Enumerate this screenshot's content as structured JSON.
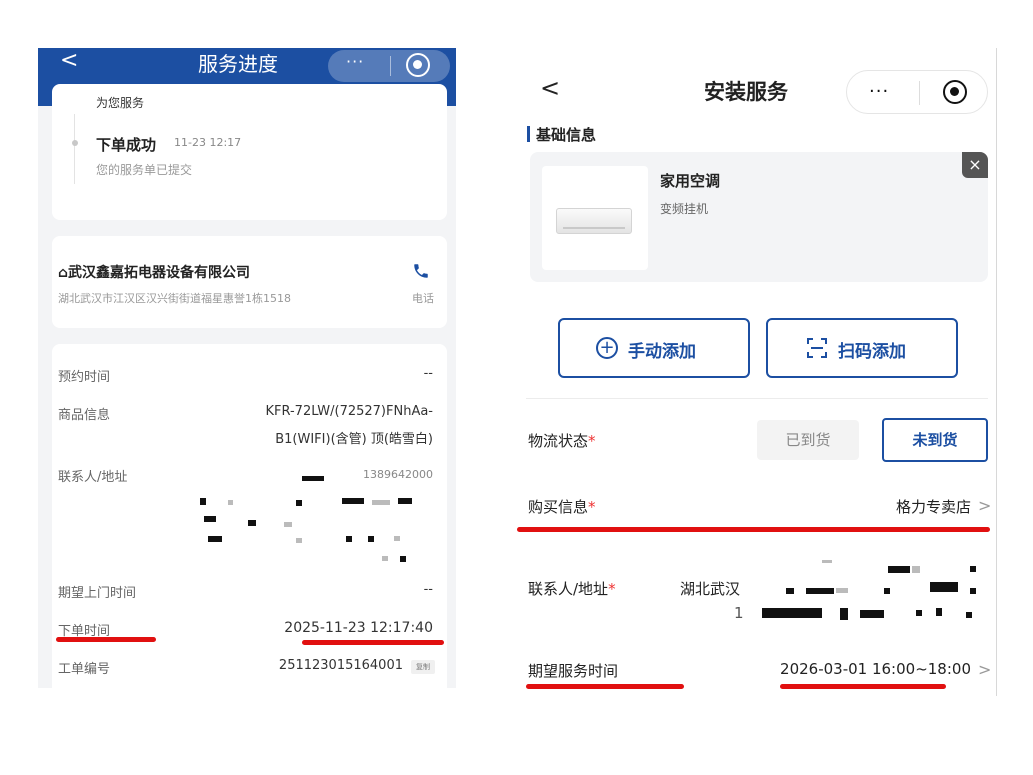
{
  "left": {
    "header": {
      "back_label": "<",
      "title": "服务进度",
      "more_icon": "···",
      "close_icon": "target-icon"
    },
    "progress": {
      "prev_text": "为您服务",
      "status": "下单成功",
      "time": "11-23 12:17",
      "sub": "您的服务单已提交"
    },
    "shop": {
      "name": "武汉鑫嘉拓电器设备有限公司",
      "address": "湖北武汉市江汉区汉兴街街道福星惠誉1栋1518",
      "phone_label": "电话"
    },
    "details": {
      "appt_label": "预约时间",
      "appt_value": "--",
      "product_label": "商品信息",
      "product_value_1": "KFR-72LW/(72527)FNhAa-",
      "product_value_2": "B1(WIFI)(含管) 顶(皓雪白)",
      "contact_label": "联系人/地址",
      "contact_partial": "1389642000",
      "visit_label": "期望上门时间",
      "visit_value": "--",
      "order_time_label": "下单时间",
      "order_time_value": "2025-11-23 12:17:40",
      "order_no_label": "工单编号",
      "order_no_value": "251123015164001",
      "copy_label": "复制"
    }
  },
  "right": {
    "header": {
      "back_label": "<",
      "title": "安装服务",
      "more_icon": "···",
      "close_icon": "target-icon"
    },
    "section_title": "基础信息",
    "product": {
      "name": "家用空调",
      "sub": "变频挂机",
      "close_label": "×"
    },
    "buttons": {
      "manual": "手动添加",
      "scan": "扫码添加"
    },
    "logistics": {
      "label": "物流状态",
      "req": "*",
      "option_arrived": "已到货",
      "option_not_arrived": "未到货"
    },
    "purchase": {
      "label": "购买信息",
      "req": "*",
      "value": "格力专卖店",
      "chevron": ">"
    },
    "contact": {
      "label": "联系人/地址",
      "req": "*",
      "value_partial": "湖北武汉",
      "value_partial2": "1"
    },
    "service_time": {
      "label": "期望服务时间",
      "value": "2026-03-01 16:00~18:00",
      "chevron": ">"
    }
  },
  "colors": {
    "brand_blue": "#1c4fa2",
    "annotation_red": "#e11010",
    "required_red": "#e33"
  }
}
